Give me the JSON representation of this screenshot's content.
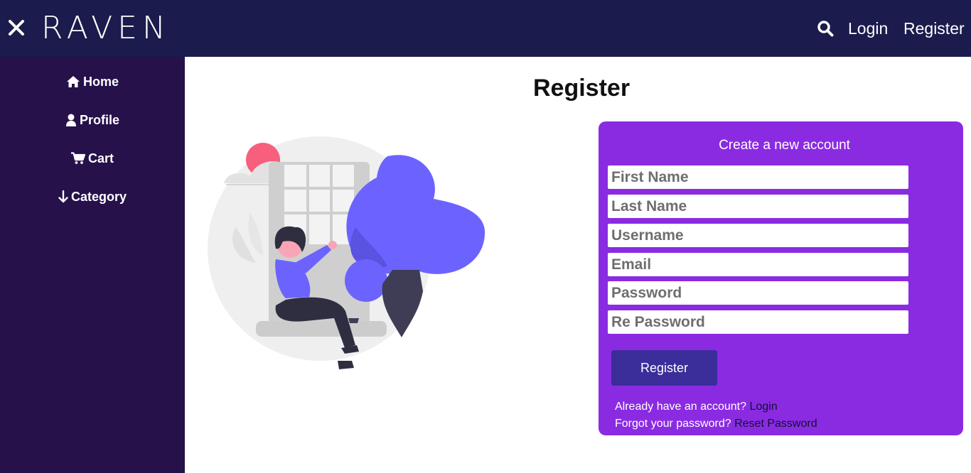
{
  "header": {
    "brand": "RAVEN",
    "nav": {
      "login": "Login",
      "register": "Register"
    },
    "icons": {
      "close": "close-icon",
      "search": "search-icon"
    },
    "color": "#1b1b4d"
  },
  "sidebar": {
    "color": "#26114b",
    "items": [
      {
        "label": "Home",
        "icon": "home-icon"
      },
      {
        "label": "Profile",
        "icon": "user-icon"
      },
      {
        "label": "Cart",
        "icon": "cart-icon"
      },
      {
        "label": "Category",
        "icon": "arrow-down-icon"
      }
    ]
  },
  "main": {
    "title": "Register",
    "form": {
      "heading": "Create a new account",
      "fields": {
        "first_name": "First Name",
        "last_name": "Last Name",
        "username": "Username",
        "email": "Email",
        "password": "Password",
        "re_password": "Re Password"
      },
      "submit_label": "Register",
      "login_prompt": "Already have an account?",
      "login_link": "Login",
      "reset_prompt": "Forgot your password?",
      "reset_link": "Reset Password",
      "card_color": "#8a2be2",
      "button_color": "#3b2d9a"
    }
  }
}
